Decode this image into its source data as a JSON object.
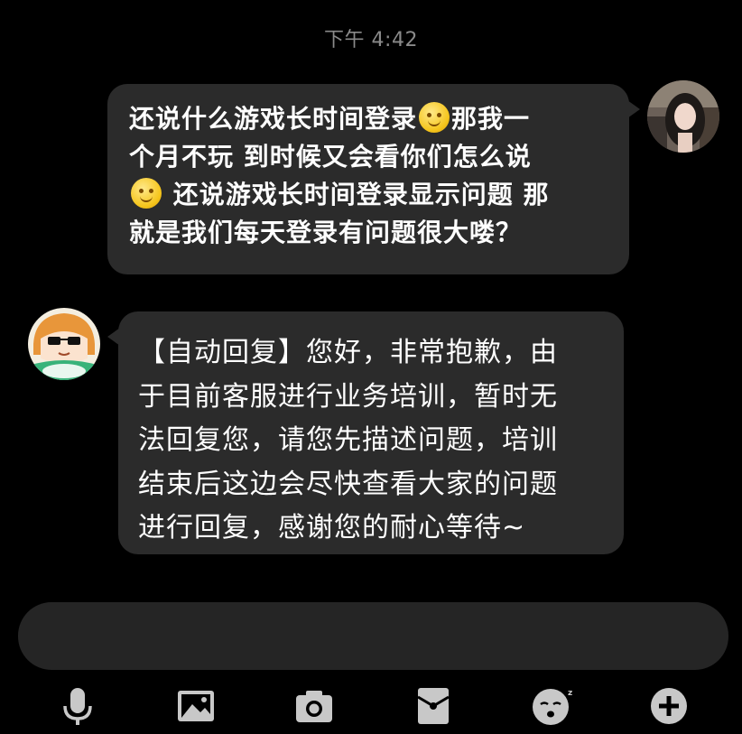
{
  "status": {
    "timestamp": "下午 4:42"
  },
  "messages": [
    {
      "sender": "user",
      "lines": [
        "还说什么游戏长时间登录[smile]那我一",
        "个月不玩 到时候又会看你们怎么说",
        "[smile] 还说游戏长时间登录显示问题 那",
        "就是我们每天登录有问题很大喽？"
      ],
      "segments": [
        [
          "还说什么游戏长时间登录",
          "那我一"
        ],
        [
          "个月不玩 到时候又会看你们怎么说"
        ],
        [
          "",
          " 还说游戏长时间登录显示问题 那"
        ],
        [
          "就是我们每天登录有问题很大喽？"
        ]
      ],
      "emoji": "smile-emoji"
    },
    {
      "sender": "service",
      "lines": [
        "【自动回复】您好，非常抱歉，由",
        "于目前客服进行业务培训，暂时无",
        "法回复您，请您先描述问题，培训",
        "结束后这边会尽快查看大家的问题",
        "进行回复，感谢您的耐心等待~"
      ]
    }
  ],
  "toolbar": {
    "icons": [
      "microphone-icon",
      "image-icon",
      "camera-icon",
      "red-envelope-icon",
      "sticker-icon",
      "plus-icon"
    ]
  },
  "colors": {
    "background": "#000000",
    "bubble": "#2b2b2b",
    "input": "#252525",
    "icon": "#c8c8c8",
    "timestamp": "#8a8a8a"
  }
}
